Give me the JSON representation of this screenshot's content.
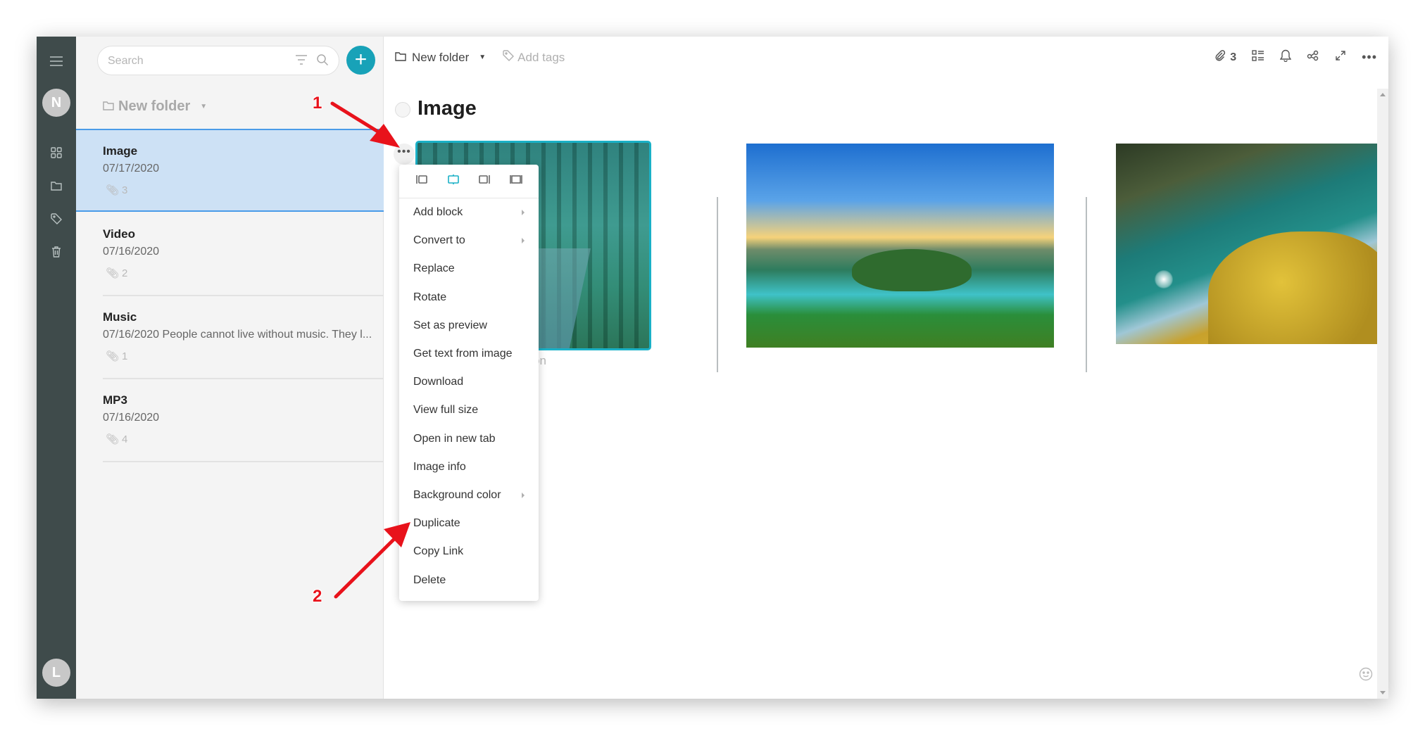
{
  "rail": {
    "user_initial": "N",
    "bottom_initial": "L",
    "icons": [
      "menu-icon",
      "grid-icon",
      "folder-icon",
      "tag-icon",
      "trash-icon"
    ]
  },
  "list": {
    "search_placeholder": "Search",
    "search_value": "",
    "add_label": "+",
    "folder_name": "New folder",
    "notes": [
      {
        "title": "Image",
        "meta": "07/17/2020",
        "attachments": "3",
        "active": true
      },
      {
        "title": "Video",
        "meta": "07/16/2020",
        "attachments": "2",
        "active": false
      },
      {
        "title": "Music",
        "meta": "07/16/2020 People cannot live without music. They l...",
        "attachments": "1",
        "active": false
      },
      {
        "title": "MP3",
        "meta": "07/16/2020",
        "attachments": "4",
        "active": false
      }
    ]
  },
  "main": {
    "breadcrumb_folder": "New folder",
    "add_tags_label": "Add tags",
    "attachment_count": "3",
    "doc_title": "Image",
    "caption_placeholder": "ption",
    "more_handle": "•••"
  },
  "menu": {
    "align_options": [
      "align-left",
      "align-center",
      "align-right",
      "full-width"
    ],
    "selected_align": "align-center",
    "items": [
      {
        "label": "Add block",
        "submenu": true
      },
      {
        "label": "Convert to",
        "submenu": true
      },
      {
        "label": "Replace",
        "submenu": false
      },
      {
        "label": "Rotate",
        "submenu": false
      },
      {
        "label": "Set as preview",
        "submenu": false
      },
      {
        "label": "Get text from image",
        "submenu": false
      },
      {
        "label": "Download",
        "submenu": false
      },
      {
        "label": "View full size",
        "submenu": false
      },
      {
        "label": "Open in new tab",
        "submenu": false
      },
      {
        "label": "Image info",
        "submenu": false
      },
      {
        "label": "Background color",
        "submenu": true
      },
      {
        "label": "Duplicate",
        "submenu": false
      },
      {
        "label": "Copy Link",
        "submenu": false
      },
      {
        "label": "Delete",
        "submenu": false
      }
    ]
  },
  "annotations": {
    "step1": "1",
    "step2": "2",
    "color": "#e8121b"
  },
  "colors": {
    "accent": "#18a2b8",
    "rail_bg": "#3f4b4b",
    "selected_note_bg": "#cde1f5"
  }
}
